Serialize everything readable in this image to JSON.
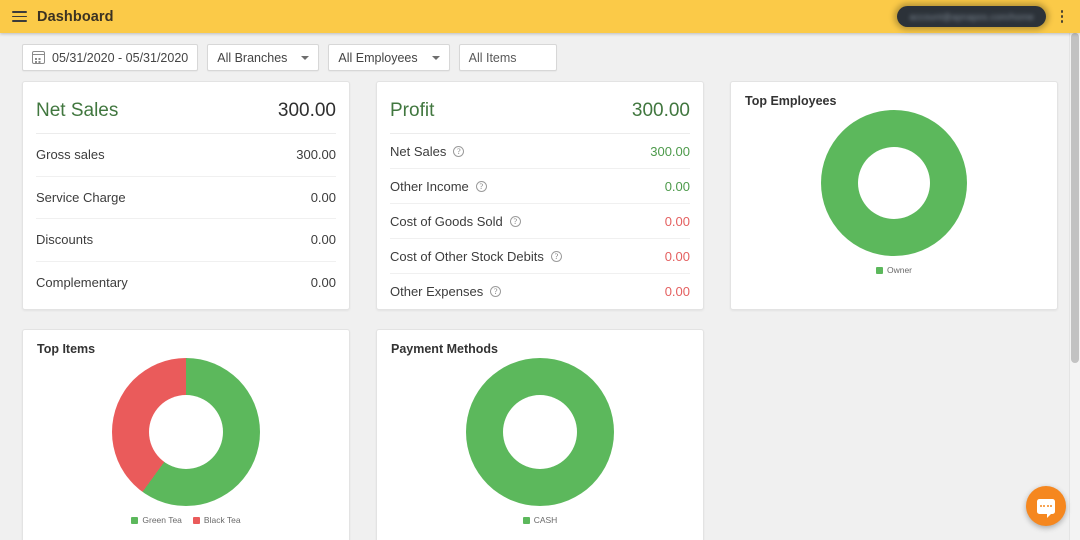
{
  "appbar": {
    "menu_icon": "hamburger-icon",
    "title": "Dashboard",
    "account_email_blurred": "account@apnapos.com/home",
    "overflow_icon": "vertical-dots-icon"
  },
  "filters": {
    "date_range": "05/31/2020 - 05/31/2020",
    "calendar_icon": "calendar-icon",
    "branches": "All Branches",
    "employees": "All Employees",
    "items_placeholder": "All Items",
    "items_value": "All Items"
  },
  "net_sales_card": {
    "title": "Net Sales",
    "total": "300.00",
    "rows": [
      {
        "label": "Gross sales",
        "value": "300.00"
      },
      {
        "label": "Service Charge",
        "value": "0.00"
      },
      {
        "label": "Discounts",
        "value": "0.00"
      },
      {
        "label": "Complementary",
        "value": "0.00"
      }
    ]
  },
  "profit_card": {
    "title": "Profit",
    "total": "300.00",
    "rows": [
      {
        "label": "Net Sales",
        "value": "300.00",
        "tone": "green"
      },
      {
        "label": "Other Income",
        "value": "0.00",
        "tone": "green"
      },
      {
        "label": "Cost of Goods Sold",
        "value": "0.00",
        "tone": "red"
      },
      {
        "label": "Cost of Other Stock Debits",
        "value": "0.00",
        "tone": "red"
      },
      {
        "label": "Other Expenses",
        "value": "0.00",
        "tone": "red"
      }
    ]
  },
  "colors": {
    "header": "#fbca48",
    "green": "#5cb85c",
    "red": "#ea5b5b",
    "title_green": "#41773f",
    "value_green": "#4d9a4b",
    "value_red": "#e46060",
    "accent_orange": "#f5871f",
    "page_bg": "#f0f0f0"
  },
  "fab": {
    "icon": "chat-bubble-icon"
  },
  "chart_data": [
    {
      "type": "pie",
      "title": "Top Employees",
      "categories": [
        "Owner"
      ],
      "values": [
        100
      ],
      "colors": [
        "#5cb85c"
      ],
      "legend_position": "bottom",
      "donut": true
    },
    {
      "type": "pie",
      "title": "Top Items",
      "categories": [
        "Green Tea",
        "Black Tea"
      ],
      "values": [
        60,
        40
      ],
      "colors": [
        "#5cb85c",
        "#ea5b5b"
      ],
      "legend_position": "bottom",
      "donut": true
    },
    {
      "type": "pie",
      "title": "Payment Methods",
      "categories": [
        "CASH"
      ],
      "values": [
        100
      ],
      "colors": [
        "#5cb85c"
      ],
      "legend_position": "bottom",
      "donut": true
    }
  ]
}
